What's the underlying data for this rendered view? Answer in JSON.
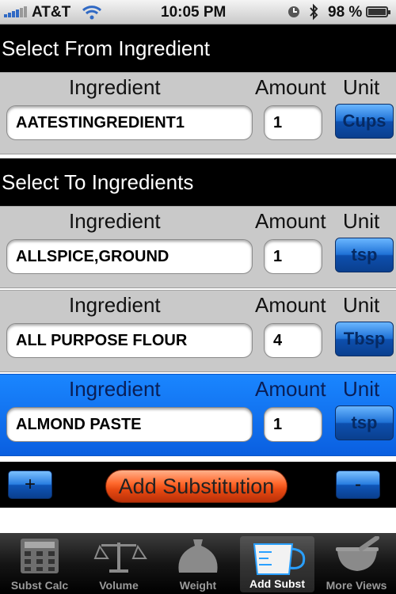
{
  "status_bar": {
    "carrier": "AT&T",
    "time": "10:05 PM",
    "battery": "98 %"
  },
  "from_section": {
    "title": "Select From Ingredient",
    "row": {
      "ingredient_label": "Ingredient",
      "amount_label": "Amount",
      "unit_label": "Unit",
      "ingredient": "AATESTINGREDIENT1",
      "amount": "1",
      "unit": "Cups"
    }
  },
  "to_section": {
    "title": "Select To Ingredients",
    "rows": [
      {
        "ingredient_label": "Ingredient",
        "amount_label": "Amount",
        "unit_label": "Unit",
        "ingredient": "ALLSPICE,GROUND",
        "amount": "1",
        "unit": "tsp",
        "selected": false
      },
      {
        "ingredient_label": "Ingredient",
        "amount_label": "Amount",
        "unit_label": "Unit",
        "ingredient": "ALL PURPOSE FLOUR",
        "amount": "4",
        "unit": "Tbsp",
        "selected": false
      },
      {
        "ingredient_label": "Ingredient",
        "amount_label": "Amount",
        "unit_label": "Unit",
        "ingredient": "ALMOND PASTE",
        "amount": "1",
        "unit": "tsp",
        "selected": true
      }
    ]
  },
  "actions": {
    "add_row": "+",
    "add_substitution": "Add Substitution",
    "remove_row": "-"
  },
  "tab_bar": {
    "active": "Add Subst",
    "tabs": [
      {
        "label": "Subst Calc",
        "icon": "calculator-icon"
      },
      {
        "label": "Volume",
        "icon": "balance-scale-icon"
      },
      {
        "label": "Weight",
        "icon": "weight-sack-icon"
      },
      {
        "label": "Add Subst",
        "icon": "measuring-cup-icon"
      },
      {
        "label": "More Views",
        "icon": "mortar-pestle-icon"
      }
    ]
  },
  "colors": {
    "selected_row": "#0a6ef0",
    "header_bg": "#000000",
    "row_bg": "#c9c9c9",
    "add_button": "#ff6a2e"
  }
}
